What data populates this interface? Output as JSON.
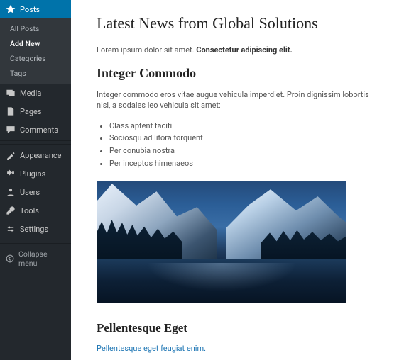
{
  "sidebar": {
    "active": {
      "label": "Posts"
    },
    "submenu": [
      {
        "label": "All Posts"
      },
      {
        "label": "Add New"
      },
      {
        "label": "Categories"
      },
      {
        "label": "Tags"
      }
    ],
    "items": [
      {
        "label": "Media"
      },
      {
        "label": "Pages"
      },
      {
        "label": "Comments"
      }
    ],
    "items2": [
      {
        "label": "Appearance"
      },
      {
        "label": "Plugins"
      },
      {
        "label": "Users"
      },
      {
        "label": "Tools"
      },
      {
        "label": "Settings"
      }
    ],
    "collapse": "Collapse menu"
  },
  "post": {
    "title": "Latest News from Global Solutions",
    "intro_plain": "Lorem ipsum dolor sit amet. ",
    "intro_bold": "Consectetur adipiscing elit.",
    "heading1": "Integer Commodo",
    "paragraph1": "Integer commodo eros vitae augue vehicula imperdiet. Proin dignissim lobortis nisi, a sodales leo vehicula sit amet:",
    "list": [
      "Class aptent taciti",
      "Sociosqu ad litora torquent",
      "Per conubia nostra",
      "Per inceptos himenaeos"
    ],
    "heading2": "Pellentesque Eget",
    "link_text": "Pellentesque eget feugiat enim."
  }
}
